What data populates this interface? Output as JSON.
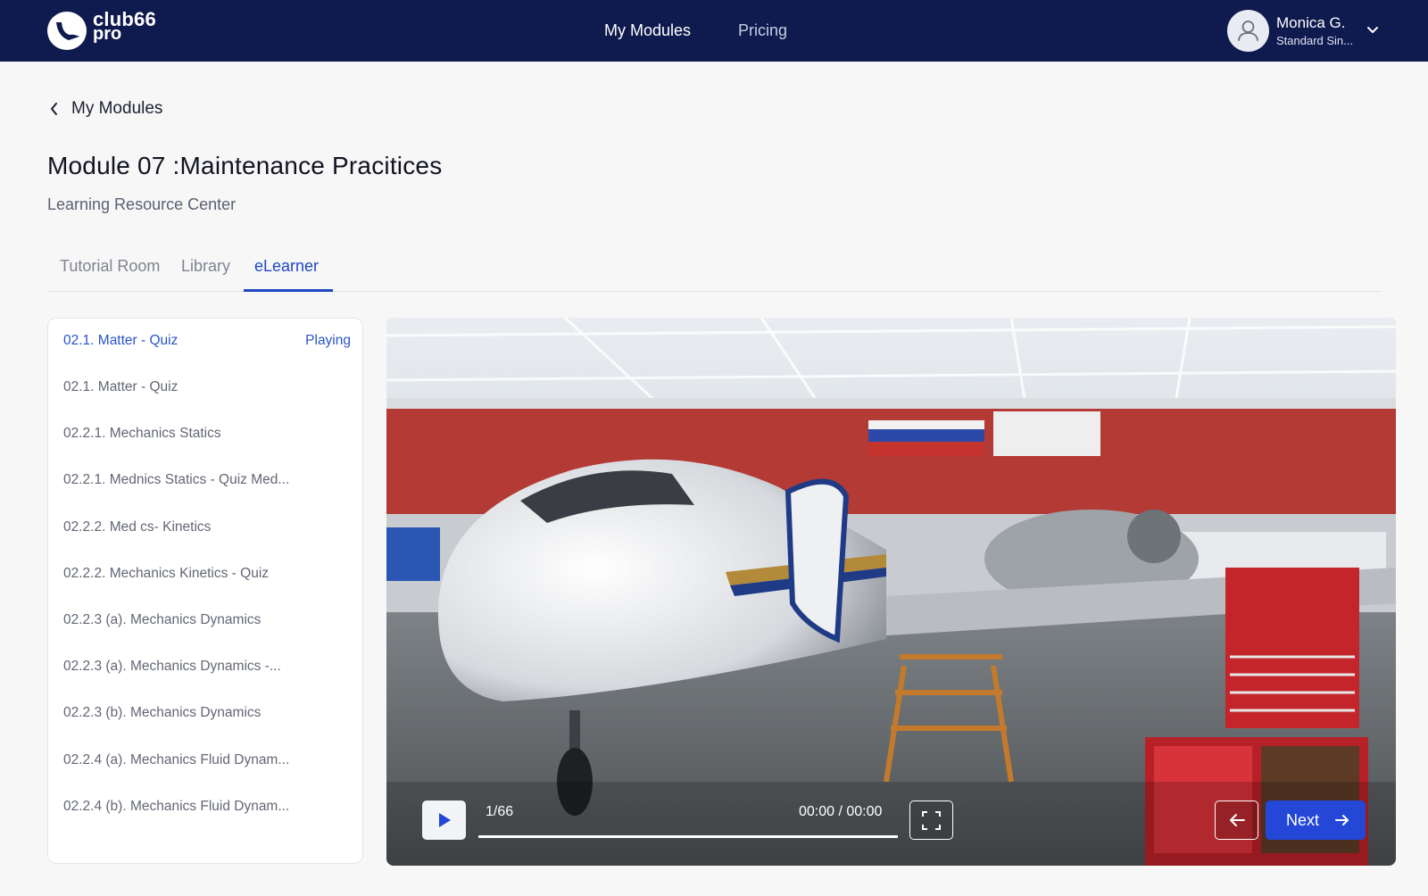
{
  "header": {
    "logo_line1": "club66",
    "logo_line2": "pro",
    "nav": [
      "My Modules",
      "Pricing"
    ],
    "user_name": "Monica G.",
    "user_plan": "Standard Sin..."
  },
  "breadcrumb": {
    "back_label": "My Modules"
  },
  "page": {
    "title": "Module 07 :Maintenance Pracitices",
    "subtitle": "Learning Resource Center"
  },
  "tabs": [
    {
      "label": "Tutorial Room"
    },
    {
      "label": "Library"
    },
    {
      "label": "eLearner",
      "active": true
    }
  ],
  "playlist": {
    "playing_label": "Playing",
    "items": [
      "02.1. Matter - Quiz",
      "02.1. Matter - Quiz",
      "02.2.1. Mechanics Statics",
      "02.2.1. Mednics Statics - Quiz Med...",
      "02.2.2. Med cs- Kinetics",
      "02.2.2. Mechanics Kinetics - Quiz",
      "02.2.3 (a). Mechanics Dynamics",
      "02.2.3 (a). Mechanics Dynamics -...",
      "02.2.3 (b). Mechanics Dynamics",
      "02.2.4 (a). Mechanics Fluid Dynam...",
      "02.2.4 (b). Mechanics Fluid Dynam..."
    ]
  },
  "player": {
    "slide_counter": "1/66",
    "time": "00:00 / 00:00",
    "progress_fraction": 1.0,
    "next_label": "Next"
  },
  "colors": {
    "header_bg": "#0f1a4e",
    "accent": "#2447d8",
    "active_text": "#2a54c9"
  },
  "icons": [
    "logo-icon",
    "user-icon",
    "chevron-down-icon",
    "chevron-left-icon",
    "play-icon",
    "fullscreen-icon",
    "arrow-left-icon",
    "arrow-right-icon"
  ]
}
